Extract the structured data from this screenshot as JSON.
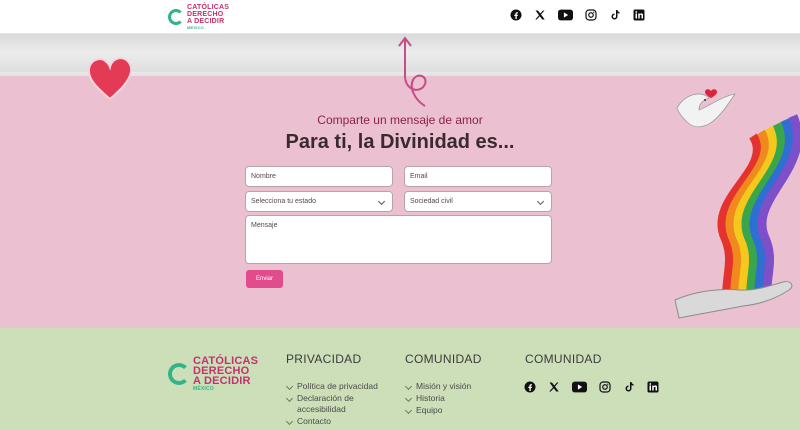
{
  "header": {
    "logo": {
      "line1": "CATÓLICAS",
      "line2": "DERECHO",
      "line3": "A DECIDIR",
      "small": "MÉXICO"
    },
    "social": [
      "facebook-icon",
      "x-icon",
      "youtube-icon",
      "instagram-icon",
      "tiktok-icon",
      "linkedin-icon"
    ]
  },
  "form": {
    "subtitle": "Comparte un mensaje de amor",
    "title": "Para ti, la Divinidad es...",
    "name_placeholder": "Nombre",
    "email_placeholder": "Email",
    "state_select": "Selecciona tu estado",
    "civil_select": "Sociedad civil",
    "message_placeholder": "Mensaje",
    "submit_label": "Enviar"
  },
  "footer": {
    "logo": {
      "line1": "CATÓLICAS",
      "line2": "DERECHO",
      "line3": "A DECIDIR",
      "small": "MÉXICO"
    },
    "col1": {
      "heading": "PRIVACIDAD",
      "items": [
        "Política de privacidad",
        "Declaración de",
        "accesibilidad",
        "Contacto"
      ]
    },
    "col2": {
      "heading": "COMUNIDAD",
      "items": [
        "Misión y visión",
        "Historia",
        "Equipo"
      ]
    },
    "col3": {
      "heading": "COMUNIDAD"
    }
  },
  "colors": {
    "accent": "#e24c8c",
    "brand_pink": "#c3316f",
    "brand_green": "#33b487",
    "pink_bg": "#ebc1d1",
    "footer_bg": "#cddfb9"
  }
}
